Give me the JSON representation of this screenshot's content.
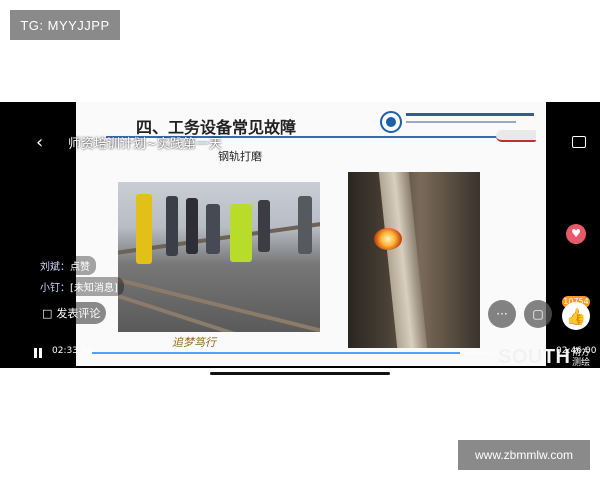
{
  "watermarks": {
    "top_left": "TG: MYYJJPP",
    "bottom_right": "www.zbmmlw.com"
  },
  "slide": {
    "title": "四、工务设备常见故障",
    "subtitle": "钢轨打磨",
    "signature": "追梦笃行"
  },
  "player": {
    "overlay_title": "师资培训计划~实践第一天",
    "chat": [
      {
        "name": "刘斌：",
        "text": "点赞"
      },
      {
        "name": "小钉：",
        "text": "[未知消息]"
      }
    ],
    "comment_label": "发表评论",
    "more_label": "···",
    "like_count": "10754",
    "current_time": "02:33:56",
    "total_time": "02:46:00",
    "progress": 0.92,
    "brand": "SOUTH",
    "brand_cn": "南方测绘"
  },
  "icons": {
    "back": "chevron-left-icon",
    "rotate": "rotate-screen-icon",
    "gift": "gift-icon",
    "like": "thumbs-up-icon",
    "pause": "pause-icon",
    "comment": "comment-icon",
    "screen": "screen-icon"
  },
  "colors": {
    "accent": "#4da3ff",
    "like_badge": "#ff9a1f"
  }
}
